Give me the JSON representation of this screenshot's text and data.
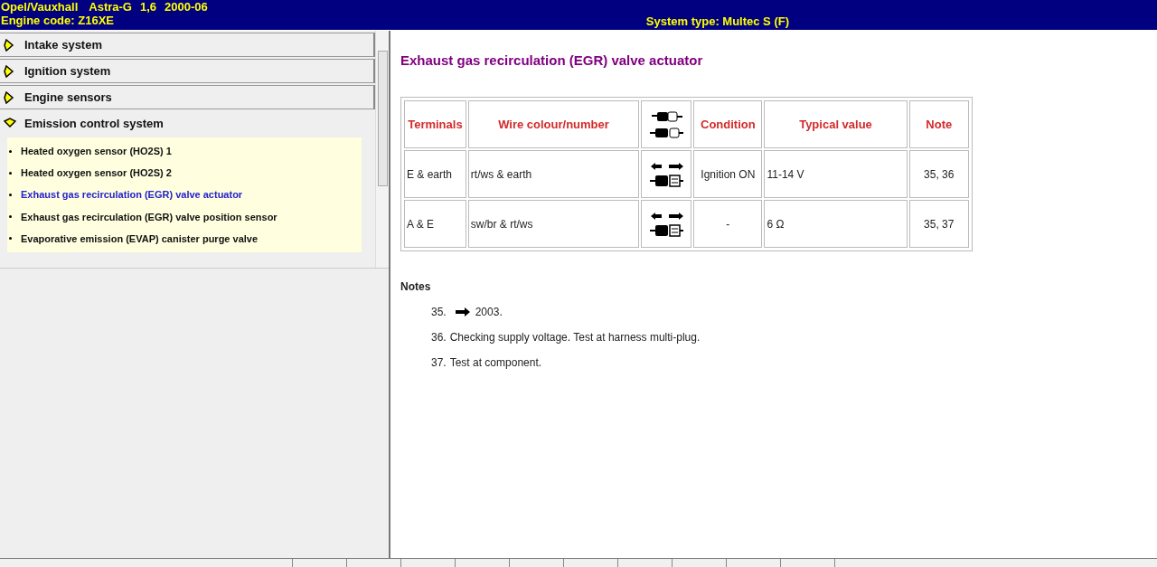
{
  "header": {
    "vehicle": [
      "Opel/Vauxhall",
      "Astra-G",
      "1,6",
      "2000-06"
    ],
    "engine_code": "Engine code: Z16XE",
    "system_type": "System type: Multec S (F)"
  },
  "sidebar": {
    "sections": [
      {
        "label": "Intake system",
        "expanded": false
      },
      {
        "label": "Ignition system",
        "expanded": false
      },
      {
        "label": "Engine sensors",
        "expanded": false
      },
      {
        "label": "Emission control system",
        "expanded": true,
        "items": [
          {
            "label": "Heated oxygen sensor (HO2S) 1",
            "selected": false
          },
          {
            "label": "Heated oxygen sensor (HO2S) 2",
            "selected": false
          },
          {
            "label": "Exhaust gas recirculation (EGR) valve actuator",
            "selected": true
          },
          {
            "label": "Exhaust gas recirculation (EGR) valve position sensor",
            "selected": false
          },
          {
            "label": "Evaporative emission (EVAP) canister purge valve",
            "selected": false
          }
        ]
      }
    ]
  },
  "content": {
    "title": "Exhaust gas recirculation (EGR) valve actuator",
    "table": {
      "columns": [
        {
          "kind": "text",
          "label": "Terminals"
        },
        {
          "kind": "text",
          "label": "Wire colour/number"
        },
        {
          "kind": "connector"
        },
        {
          "kind": "text",
          "label": "Condition"
        },
        {
          "kind": "text",
          "label": "Typical value"
        },
        {
          "kind": "text",
          "label": "Note"
        }
      ],
      "rows": [
        {
          "terminals": "E & earth",
          "wire": "rt/ws & earth",
          "kind": "measure",
          "condition": "Ignition ON",
          "value": "11-14 V",
          "note": "35, 36"
        },
        {
          "terminals": "A & E",
          "wire": "sw/br & rt/ws",
          "kind": "measure",
          "condition": "-",
          "value": "6 Ω",
          "note": "35, 37"
        }
      ]
    },
    "notes_heading": "Notes",
    "notes": [
      {
        "kind": "arrow",
        "number": "35.",
        "text": "2003."
      },
      {
        "kind": "plain",
        "number": "36.",
        "text": "Checking supply voltage. Test at harness multi-plug."
      },
      {
        "kind": "plain",
        "number": "37.",
        "text": "Test at component."
      }
    ]
  }
}
